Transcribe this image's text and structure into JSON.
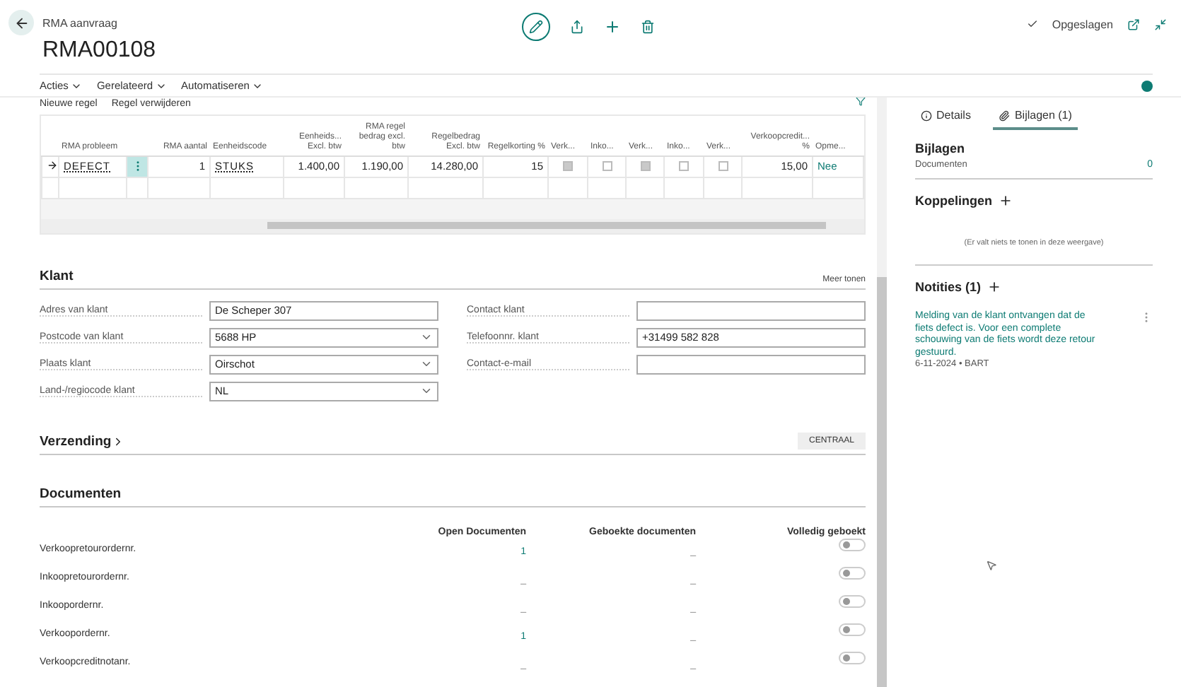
{
  "header": {
    "breadcrumb": "RMA aanvraag",
    "title": "RMA00108",
    "status": "Opgeslagen"
  },
  "action_bar": {
    "menus": [
      "Acties",
      "Gerelateerd",
      "Automatiseren"
    ]
  },
  "lines": {
    "toolbar": [
      "Nieuwe regel",
      "Regel verwijderen"
    ],
    "columns": [
      {
        "label": "RMA probleem"
      },
      {},
      {
        "label": "RMA aantal"
      },
      {
        "label": "Eenheidscode"
      },
      {
        "label": "Eenheids... Excl. btw"
      },
      {
        "label": "RMA regel bedrag excl. btw"
      },
      {
        "label": "Regelbedrag Excl. btw"
      },
      {
        "label": "Regelkorting %"
      },
      {
        "label": "Verk..."
      },
      {
        "label": "Inko..."
      },
      {
        "label": "Verk..."
      },
      {
        "label": "Inko..."
      },
      {
        "label": "Verk..."
      },
      {
        "label": "Verkoopcredit... %"
      },
      {
        "label": "Opme..."
      }
    ],
    "rows": [
      {
        "current": true,
        "cells": [
          {
            "kind": "code",
            "text": "DEFECT"
          },
          {
            "kind": "menu"
          },
          {
            "kind": "number",
            "text": "1"
          },
          {
            "kind": "code",
            "text": "STUKS"
          },
          {
            "kind": "number",
            "text": "1.400,00"
          },
          {
            "kind": "number",
            "text": "1.190,00"
          },
          {
            "kind": "number",
            "text": "14.280,00"
          },
          {
            "kind": "number",
            "text": "15"
          },
          {
            "kind": "checkbox",
            "checked": true
          },
          {
            "kind": "checkbox",
            "checked": false
          },
          {
            "kind": "checkbox",
            "checked": true
          },
          {
            "kind": "checkbox",
            "checked": false
          },
          {
            "kind": "checkbox",
            "checked": false
          },
          {
            "kind": "number",
            "text": "15,00"
          },
          {
            "kind": "link",
            "text": "Nee"
          }
        ]
      }
    ]
  },
  "klant": {
    "title": "Klant",
    "more": "Meer tonen",
    "left_fields": [
      {
        "label": "Adres van klant",
        "kind": "text",
        "value": "De Scheper 307"
      },
      {
        "label": "Postcode van klant",
        "kind": "select",
        "value": "5688 HP"
      },
      {
        "label": "Plaats klant",
        "kind": "select",
        "value": "Oirschot"
      },
      {
        "label": "Land-/regiocode klant",
        "kind": "select",
        "value": "NL"
      }
    ],
    "right_fields": [
      {
        "label": "Contact klant",
        "kind": "text"
      },
      {
        "label": "Telefoonnr. klant",
        "kind": "text",
        "value": "+31499 582 828"
      },
      {
        "label": "Contact-e-mail",
        "kind": "text"
      }
    ]
  },
  "verzending": {
    "title": "Verzending",
    "badge": "CENTRAAL"
  },
  "documenten": {
    "title": "Documenten",
    "columns": [
      "Open Documenten",
      "Geboekte documenten",
      "Volledig geboekt"
    ],
    "rows": [
      {
        "label": "Verkoopretourordernr.",
        "open": "1",
        "posted": "_",
        "complete": false
      },
      {
        "label": "Inkoopretourordernr.",
        "open": "_",
        "posted": "_",
        "complete": false
      },
      {
        "label": "Inkoopordernr.",
        "open": "_",
        "posted": "_",
        "complete": false
      },
      {
        "label": "Verkoopordernr.",
        "open": "1",
        "posted": "_",
        "complete": false
      },
      {
        "label": "Verkoopcreditnotanr.",
        "open": "_",
        "posted": "_",
        "complete": false
      }
    ]
  },
  "side_pane": {
    "tabs": [
      {
        "label": "Details",
        "selected": false
      },
      {
        "label": "Bijlagen (1)",
        "selected": true
      }
    ],
    "bijlagen": {
      "title": "Bijlagen",
      "label": "Documenten",
      "value": "0"
    },
    "koppelingen": {
      "title": "Koppelingen",
      "empty": "(Er valt niets te tonen in deze weergave)"
    },
    "notities": {
      "title": "Notities (1)",
      "notes": [
        {
          "text": "Melding van de klant ontvangen dat de fiets defect is. Voor een complete schouwing van de fiets wordt deze retour gestuurd.",
          "meta": "6-11-2024 • BART"
        }
      ]
    }
  }
}
